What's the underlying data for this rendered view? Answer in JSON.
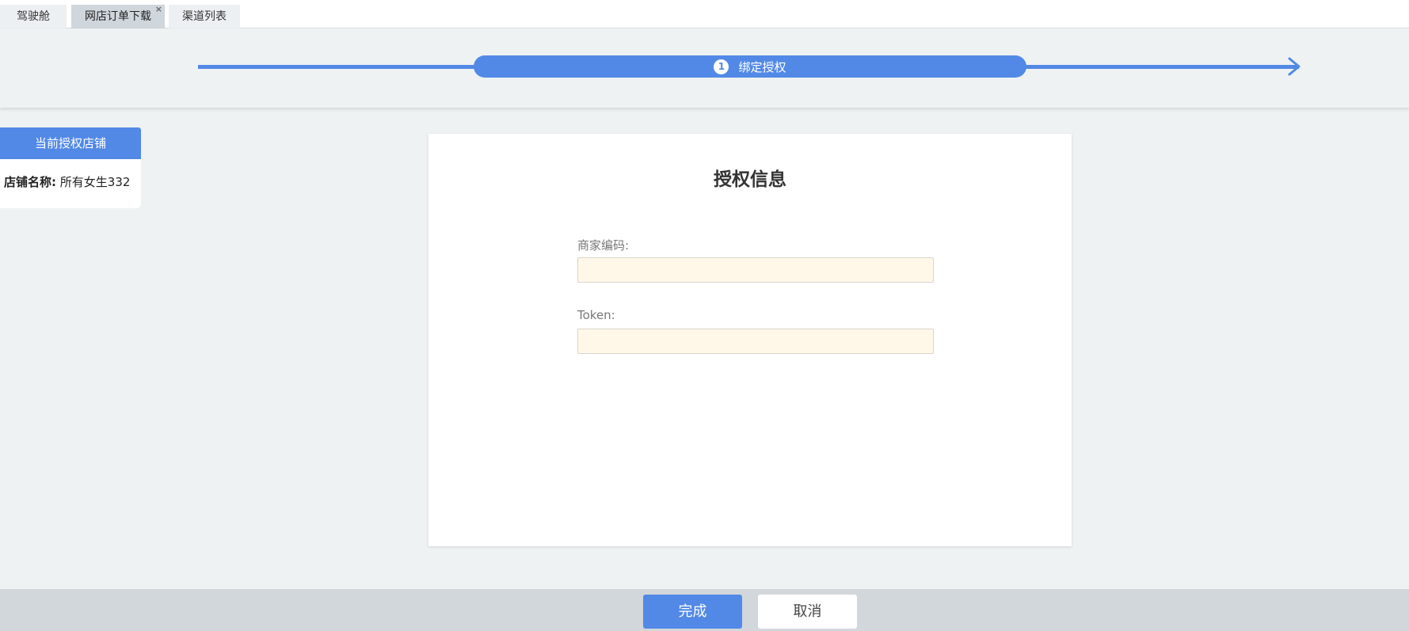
{
  "tabs": [
    {
      "label": "驾驶舱",
      "active": false
    },
    {
      "label": "网店订单下载",
      "active": true,
      "close": "×"
    },
    {
      "label": "渠道列表",
      "active": false
    }
  ],
  "stepper": {
    "steps": [
      {
        "number": "1",
        "label": "绑定授权",
        "active": true
      }
    ],
    "color": "#5289e6"
  },
  "shop_panel": {
    "header": "当前授权店铺",
    "name_label": "店铺名称:",
    "name_value": "所有女生332"
  },
  "auth_card": {
    "title": "授权信息",
    "fields": [
      {
        "label": "商家编码:",
        "value": "",
        "placeholder": ""
      },
      {
        "label": "Token:",
        "value": "",
        "placeholder": ""
      }
    ]
  },
  "actions": {
    "confirm": "完成",
    "cancel": "取消"
  }
}
